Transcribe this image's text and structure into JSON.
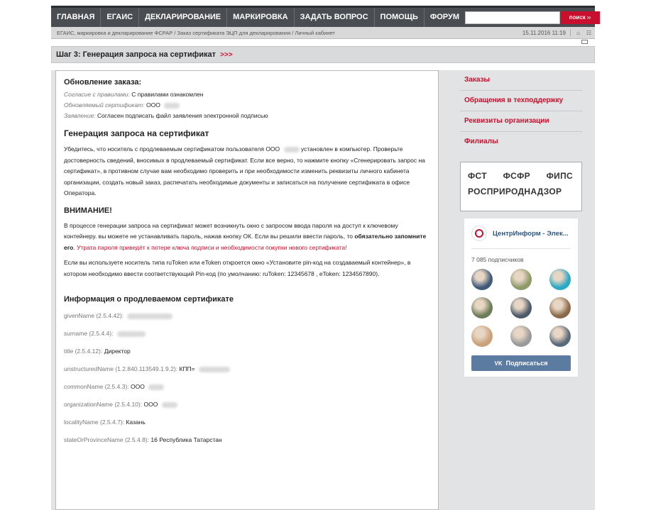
{
  "nav": {
    "items": [
      "ГЛАВНАЯ",
      "ЕГАИС",
      "ДЕКЛАРИРОВАНИЕ",
      "МАРКИРОВКА",
      "ЗАДАТЬ ВОПРОС",
      "ПОМОЩЬ",
      "ФОРУМ"
    ],
    "search_placeholder": "",
    "search_button": "поиск ››"
  },
  "breadcrumb": {
    "text": "ЕГАИС, маркировка и декларирование ФСРАР / Заказ сертификата ЭЦП для декларирования / Личный кабинет",
    "date": "15.11.2016 11:19"
  },
  "step": {
    "title": "Шаг 3: Генерация запроса на сертификат",
    "arrows": ">>>"
  },
  "main": {
    "update_title": "Обновление заказа:",
    "agree_label": "Согласие с правилами:",
    "agree_value": "С правилами ознакомлен",
    "cert_label": "Обновляемый сертификат:",
    "cert_value": "ООО",
    "statement_label": "Заявление:",
    "statement_value": "Согласен подписать файл заявления электронной подписью",
    "gen_title": "Генерация запроса на сертификат",
    "para1_a": "Убедитесь, что носитель с продлеваемым сертификатом пользователя ООО",
    "para1_b": "установлен в компьютер. Проверьте достоверность сведений, вносимых в продлеваемый сертификат. Если все верно, то нажмите кнопку «Сгенерировать запрос на сертификат», в противном случае вам необходимо проверить и при необходимости изменить реквизиты личного кабинета организации, создать новый заказ, распечатать необходимые документы и записаться на получение сертификата в офисе Оператора.",
    "attention": "ВНИМАНИЕ!",
    "para2_a": "В процессе генерации запроса на сертификат может возникнуть окно с запросом ввода пароля на доступ к ключевому контейнеру. вы можете не устанавливать пароль, нажав кнопку ОК. Если вы решили ввести пароль, то",
    "para2_b": "обязательно запомните его",
    "para2_c": ".",
    "para2_warn": "Утрата пароля приведёт к потере ключа подписи и необходимости покупки нового сертификата!",
    "para3": "Если вы используете носитель типа ruToken или eToken откроется окно «Установите pin-код на создаваемый контейнер», в котором необходимо ввести соответствующий Pin-код (по умолчанию: ruToken: 12345678 , eToken: 1234567890).",
    "info_title": "Информация о продлеваемом сертификате",
    "attrs": [
      {
        "k": "givenName (2.5.4.42):",
        "v": ""
      },
      {
        "k": "surname (2.5.4.4):",
        "v": ""
      },
      {
        "k": "title (2.5.4.12):",
        "v": "Директор"
      },
      {
        "k": "unstructuredName (1.2.840.113549.1.9.2):",
        "v": "КПП="
      },
      {
        "k": "commonName (2.5.4.3):",
        "v": "ООО"
      },
      {
        "k": "organizationName (2.5.4.10):",
        "v": "ООО"
      },
      {
        "k": "localityName (2.5.4.7):",
        "v": "Казань"
      },
      {
        "k": "stateOrProvinceName (2.5.4.8):",
        "v": "16 Республика Татарстан"
      }
    ]
  },
  "sidebar": {
    "links": [
      "Заказы",
      "Обращения в техподдержку",
      "Реквизиты организации",
      "Филиалы"
    ],
    "logos": {
      "l1": "ФСТ",
      "l2": "ФСФР",
      "l3": "ФИПС",
      "l4": "РОСПРИРОДНАДЗОР"
    }
  },
  "vk": {
    "name": "ЦентрИнформ - Элек...",
    "subscribers": "7 085 подписчиков",
    "button": "Подписаться",
    "avatar_colors": [
      "#3f5a78",
      "#8c9a6a",
      "#2aa8c4",
      "#6b7d5a",
      "#4d5a6a",
      "#8a6a4a",
      "#c9a17a",
      "#9a9a9a",
      "#5a6a7a"
    ]
  },
  "colors": {
    "accent": "#c8102e",
    "nav_bg": "#4a4d52",
    "vk_blue": "#5b7ba1"
  }
}
